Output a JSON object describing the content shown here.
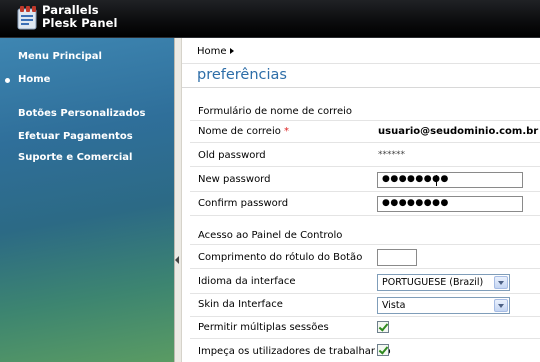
{
  "header": {
    "logo_line1": "Parallels",
    "logo_line2": "Plesk Panel"
  },
  "sidebar": {
    "main_menu": "Menu Principal",
    "home": "Home",
    "custom_buttons": "Botões Personalizados",
    "payments": "Efetuar Pagamentos",
    "support": "Suporte e Comercial"
  },
  "breadcrumb": {
    "home": "Home"
  },
  "page": {
    "title": "preferências"
  },
  "mail_form": {
    "section_title": "Formulário de nome de correio",
    "mail_name_label": "Nome de correio",
    "required_mark": "*",
    "mail_name_value": "usuario@seudominio.com.br",
    "old_password_label": "Old password",
    "old_password_value": "******",
    "new_password_label": "New password",
    "new_password_value": "●●●●●●●●",
    "confirm_password_label": "Confirm password",
    "confirm_password_value": "●●●●●●●●"
  },
  "cp_access": {
    "section_title": "Acesso ao Painel de Controlo",
    "button_label_length_label": "Comprimento do rótulo do Botão",
    "button_label_length_value": "",
    "language_label": "Idioma da interface",
    "language_value": "PORTUGUESE (Brazil)",
    "skin_label": "Skin da Interface",
    "skin_value": "Vista",
    "multiple_sessions_label": "Permitir múltiplas sessões",
    "multiple_sessions_checked": true,
    "prevent_users_label": "Impeça os utilizadores de trabalhar no",
    "prevent_users_checked": true
  }
}
